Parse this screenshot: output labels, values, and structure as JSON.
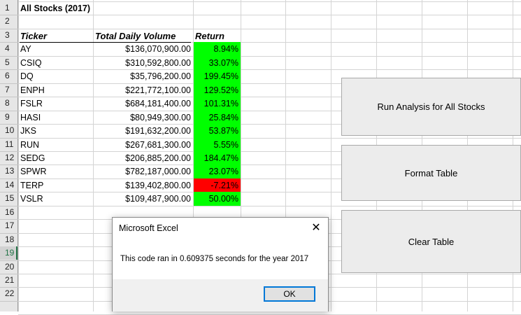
{
  "sheet": {
    "title": "All Stocks (2017)",
    "headers": {
      "ticker": "Ticker",
      "volume": "Total Daily Volume",
      "return": "Return"
    },
    "row_numbers": [
      "1",
      "2",
      "3",
      "4",
      "5",
      "6",
      "7",
      "8",
      "9",
      "10",
      "11",
      "12",
      "13",
      "14",
      "15",
      "16",
      "17",
      "18",
      "19",
      "20",
      "21",
      "22"
    ],
    "selected_row": "19",
    "rows": [
      {
        "ticker": "AY",
        "volume": "$136,070,900.00",
        "return": "8.94%",
        "status": "positive"
      },
      {
        "ticker": "CSIQ",
        "volume": "$310,592,800.00",
        "return": "33.07%",
        "status": "positive"
      },
      {
        "ticker": "DQ",
        "volume": "$35,796,200.00",
        "return": "199.45%",
        "status": "positive"
      },
      {
        "ticker": "ENPH",
        "volume": "$221,772,100.00",
        "return": "129.52%",
        "status": "positive"
      },
      {
        "ticker": "FSLR",
        "volume": "$684,181,400.00",
        "return": "101.31%",
        "status": "positive"
      },
      {
        "ticker": "HASI",
        "volume": "$80,949,300.00",
        "return": "25.84%",
        "status": "positive"
      },
      {
        "ticker": "JKS",
        "volume": "$191,632,200.00",
        "return": "53.87%",
        "status": "positive"
      },
      {
        "ticker": "RUN",
        "volume": "$267,681,300.00",
        "return": "5.55%",
        "status": "positive"
      },
      {
        "ticker": "SEDG",
        "volume": "$206,885,200.00",
        "return": "184.47%",
        "status": "positive"
      },
      {
        "ticker": "SPWR",
        "volume": "$782,187,000.00",
        "return": "23.07%",
        "status": "positive"
      },
      {
        "ticker": "TERP",
        "volume": "$139,402,800.00",
        "return": "-7.21%",
        "status": "negative"
      },
      {
        "ticker": "VSLR",
        "volume": "$109,487,900.00",
        "return": "50.00%",
        "status": "positive"
      }
    ],
    "colors": {
      "positive": "#00ff00",
      "negative": "#ff0000"
    }
  },
  "buttons": {
    "run_analysis": "Run Analysis for All Stocks",
    "format_table": "Format Table",
    "clear_table": "Clear Table"
  },
  "dialog": {
    "title": "Microsoft Excel",
    "message": "This code ran in 0.609375 seconds for the year 2017",
    "ok_label": "OK",
    "close_icon": "close-icon"
  }
}
